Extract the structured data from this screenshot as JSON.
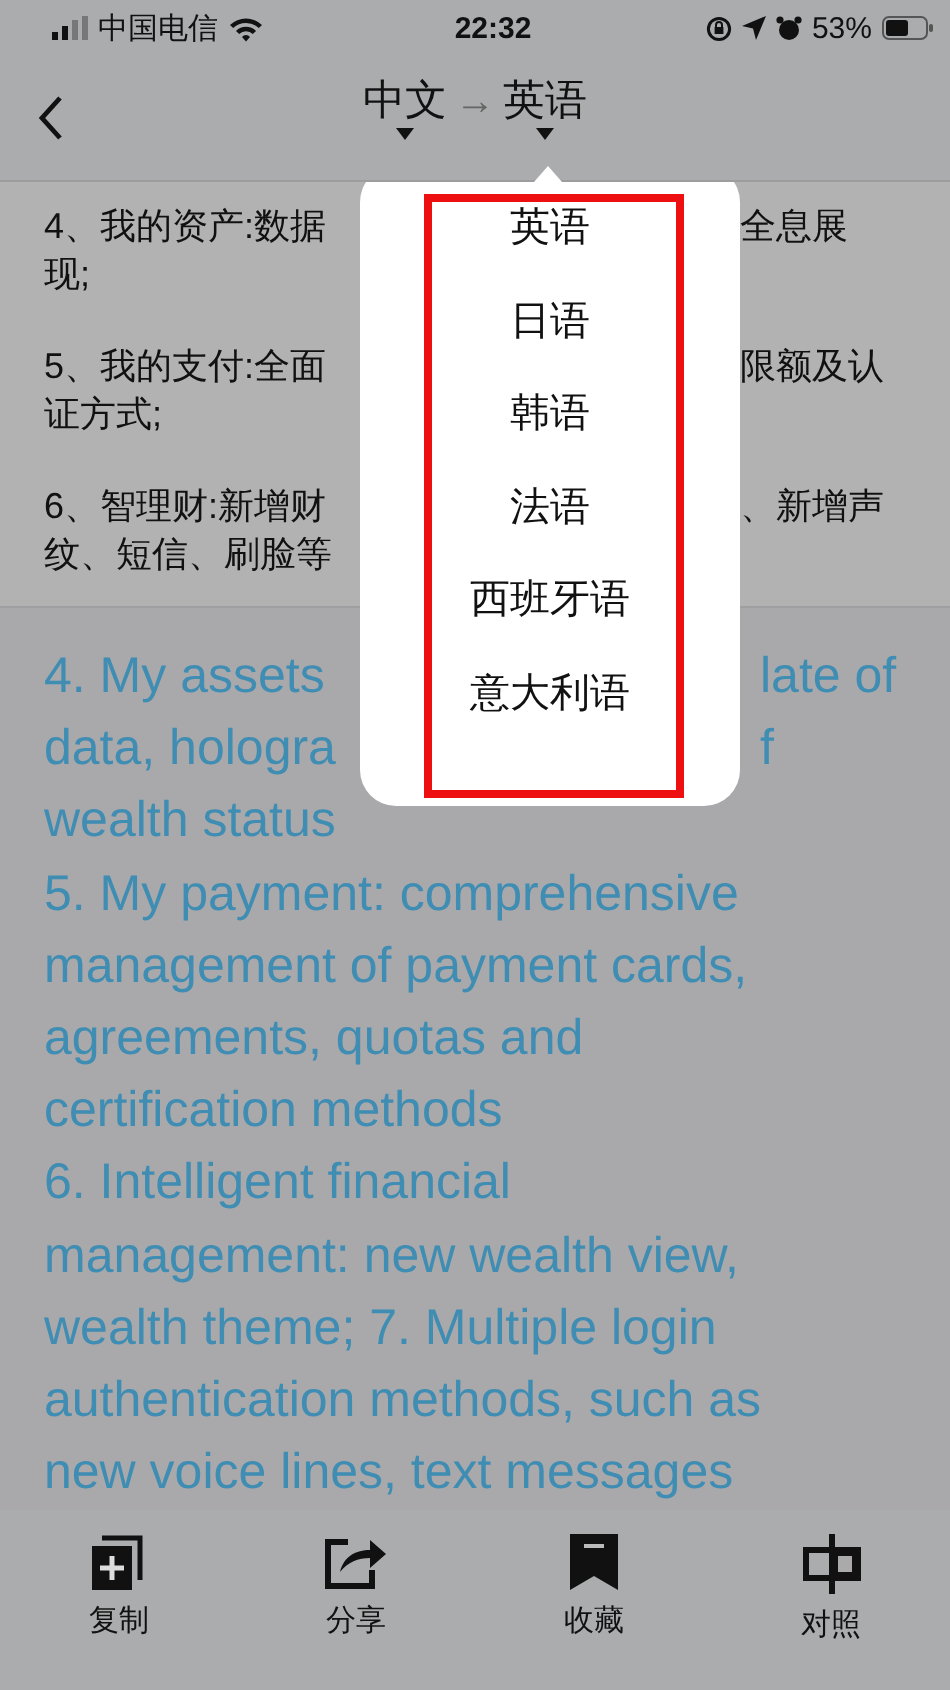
{
  "status_bar": {
    "carrier": "中国电信",
    "time": "22:32",
    "battery": "53%"
  },
  "nav": {
    "source": "中文",
    "arrow": "→",
    "target": "英语"
  },
  "source_paragraphs": [
    {
      "lines": [
        {
          "left": "4、我的资产:数据",
          "right": "全息展"
        },
        {
          "left": "现;"
        }
      ]
    },
    {
      "lines": [
        {
          "left": "5、我的支付:全面",
          "right": "限额及认"
        },
        {
          "left": "证方式;"
        }
      ]
    },
    {
      "lines": [
        {
          "left": "6、智理财:新增财",
          "right": "、新增声"
        },
        {
          "left": "纹、短信、刷脸等"
        }
      ]
    }
  ],
  "translation_lines": [
    {
      "left": "4. My assets",
      "right": "late of"
    },
    {
      "left": "data, hologra",
      "right": "f"
    },
    {
      "left": "wealth status"
    },
    {
      "left": "5. My payment: comprehensive"
    },
    {
      "left": "management of payment cards,"
    },
    {
      "left": "agreements, quotas and"
    },
    {
      "left": "certification methods"
    },
    {
      "left": "6. Intelligent financial"
    },
    {
      "left": "management: new wealth view,"
    },
    {
      "left": "wealth theme; 7. Multiple login"
    },
    {
      "left": "authentication methods, such as"
    },
    {
      "left": "new voice lines, text messages"
    }
  ],
  "language_menu": {
    "items": [
      {
        "label": "英语"
      },
      {
        "label": "日语"
      },
      {
        "label": "韩语"
      },
      {
        "label": "法语"
      },
      {
        "label": "西班牙语"
      },
      {
        "label": "意大利语"
      }
    ]
  },
  "toolbar": [
    {
      "label": "复制",
      "kind": "copy"
    },
    {
      "label": "分享",
      "kind": "share"
    },
    {
      "label": "收藏",
      "kind": "bookmark"
    },
    {
      "label": "对照",
      "kind": "compare"
    }
  ]
}
